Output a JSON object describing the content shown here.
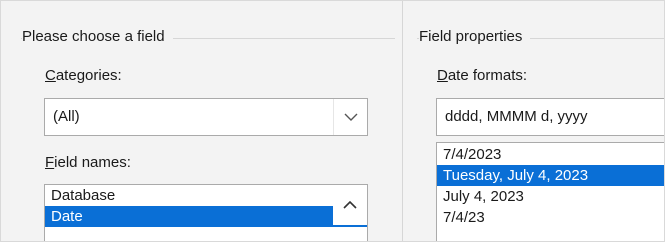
{
  "left_group": {
    "title": "Please choose a field",
    "categories_label_accel": "C",
    "categories_label_rest": "ategories:",
    "categories_value": "(All)",
    "field_names_label_accel": "F",
    "field_names_label_rest": "ield names:",
    "field_names": [
      {
        "label": "Database",
        "selected": false
      },
      {
        "label": "Date",
        "selected": true
      }
    ]
  },
  "right_group": {
    "title": "Field properties",
    "date_formats_label_accel": "D",
    "date_formats_label_rest": "ate formats:",
    "date_format_value": "dddd, MMMM d, yyyy",
    "date_formats": [
      {
        "label": "7/4/2023",
        "selected": false
      },
      {
        "label": "Tuesday, July 4, 2023",
        "selected": true
      },
      {
        "label": "July 4, 2023",
        "selected": false
      },
      {
        "label": "7/4/23",
        "selected": false
      }
    ]
  },
  "colors": {
    "selection": "#0a6fd6",
    "selection_text": "#ffffff"
  },
  "icons": {
    "combo_dropdown": "chevron-down-icon",
    "scroll_up": "chevron-up-icon"
  }
}
